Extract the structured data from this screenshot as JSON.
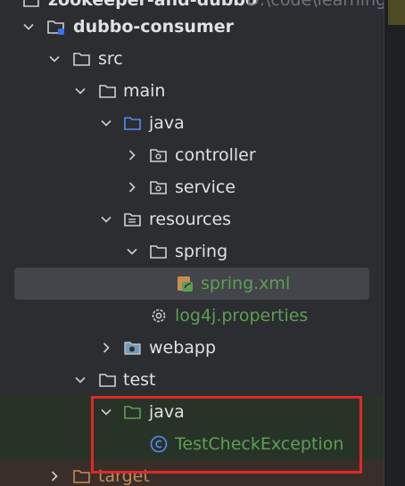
{
  "project_tree": {
    "top_partial_title": "zookeeper-and-dubbo",
    "top_partial_path": "D:\\code\\learning",
    "rows": [
      {
        "label": "dubbo-consumer",
        "icon": "module-folder-icon",
        "expanded": true
      },
      {
        "label": "src",
        "icon": "folder-icon",
        "expanded": true
      },
      {
        "label": "main",
        "icon": "folder-icon",
        "expanded": true
      },
      {
        "label": "java",
        "icon": "source-root-folder-icon",
        "expanded": true
      },
      {
        "label": "controller",
        "icon": "package-icon",
        "expanded": false
      },
      {
        "label": "service",
        "icon": "package-icon",
        "expanded": false
      },
      {
        "label": "resources",
        "icon": "resources-folder-icon",
        "expanded": true
      },
      {
        "label": "spring",
        "icon": "folder-icon",
        "expanded": true
      },
      {
        "label": "spring.xml",
        "icon": "spring-xml-icon",
        "selected": true
      },
      {
        "label": "log4j.properties",
        "icon": "properties-gear-icon"
      },
      {
        "label": "webapp",
        "icon": "web-folder-icon",
        "expanded": false
      },
      {
        "label": "test",
        "icon": "folder-icon",
        "expanded": true
      },
      {
        "label": "java",
        "icon": "test-root-folder-icon",
        "expanded": true
      },
      {
        "label": "TestCheckException",
        "icon": "java-class-icon"
      },
      {
        "label": "target",
        "icon": "excluded-folder-icon",
        "expanded": false
      }
    ]
  },
  "colors": {
    "background": "#2b2d30",
    "text": "#dfe1e5",
    "green_text": "#5f9e55",
    "selection": "#43454a",
    "highlight_box": "#e0282b",
    "target_text": "#c78c55"
  }
}
